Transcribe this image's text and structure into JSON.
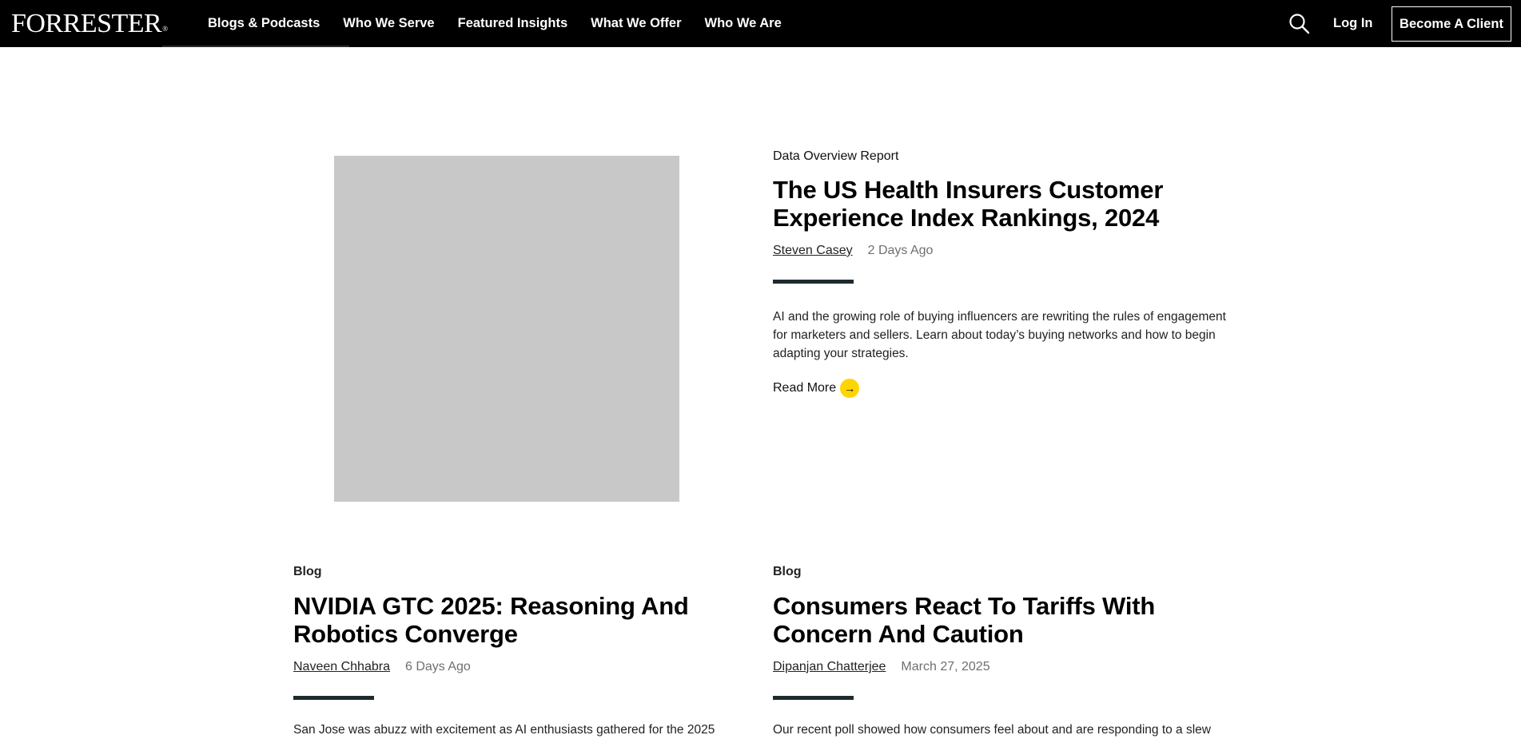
{
  "header": {
    "logo": "FORRESTER",
    "logo_mark": "®",
    "nav": [
      {
        "label": "Blogs & Podcasts"
      },
      {
        "label": "Who We Serve"
      },
      {
        "label": "Featured Insights"
      },
      {
        "label": "What We Offer"
      },
      {
        "label": "Who We Are"
      }
    ],
    "search_icon": "search-icon",
    "login_label": "Log In",
    "cta_label": "Become A Client"
  },
  "feature": {
    "eyebrow": "Data Overview Report",
    "title": "The US Health Insurers Customer Experience Index Rankings, 2024",
    "author": "Steven Casey",
    "date": "2 Days Ago",
    "description": "AI and the growing role of buying influencers are rewriting the rules of engagement for marketers and sellers. Learn about today’s buying networks and how to begin adapting your strategies.",
    "read_more": "Read More",
    "arrow_icon": "→"
  },
  "cards": [
    {
      "label": "Blog",
      "title": "NVIDIA GTC 2025: Reasoning And Robotics Converge",
      "author": "Naveen Chhabra",
      "date": "6 Days Ago",
      "snippet": "San Jose was abuzz with excitement as AI enthusiasts gathered for the 2025"
    },
    {
      "label": "Blog",
      "title": "Consumers React To Tariffs With Concern And Caution",
      "author": "Dipanjan Chatterjee",
      "date": "March 27, 2025",
      "snippet": "Our recent poll showed how consumers feel about and are responding to a slew"
    }
  ],
  "colors": {
    "header_bg": "#000000",
    "accent_yellow": "#ffd500",
    "rule": "#1f2a2f",
    "image_placeholder": "#c8c8c8"
  }
}
